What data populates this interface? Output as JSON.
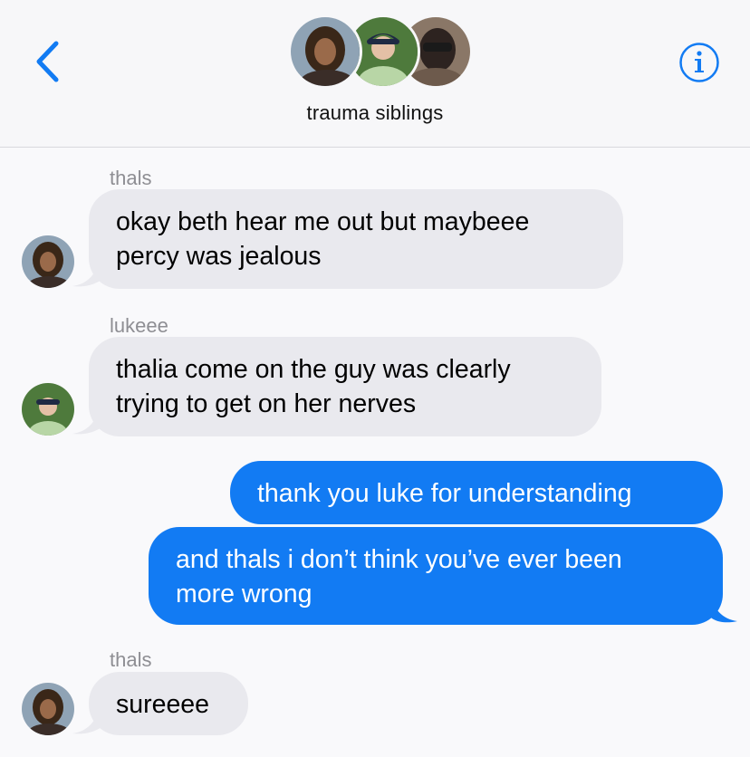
{
  "header": {
    "group_name": "trauma siblings",
    "back_icon": "chevron-left-icon",
    "info_icon": "info-circle-icon",
    "accent_color": "#127bf3"
  },
  "messages": [
    {
      "sender": "thals",
      "text_lines": [
        "okay beth hear me out but maybeee",
        "percy was jealous"
      ],
      "direction": "received"
    },
    {
      "sender": "lukeee",
      "text_lines": [
        "thalia come on the guy was clearly",
        "trying to get on her nerves"
      ],
      "direction": "received"
    },
    {
      "text_lines": [
        "thank you luke for understanding"
      ],
      "direction": "sent"
    },
    {
      "text_lines": [
        "and thals i don’t think you’ve ever been",
        "more wrong"
      ],
      "direction": "sent"
    },
    {
      "sender": "thals",
      "text_lines": [
        "sureeee"
      ],
      "direction": "received"
    }
  ],
  "colors": {
    "received_bubble": "#e9e9ee",
    "sent_bubble": "#127bf3",
    "sender_label": "#8e8e93"
  }
}
